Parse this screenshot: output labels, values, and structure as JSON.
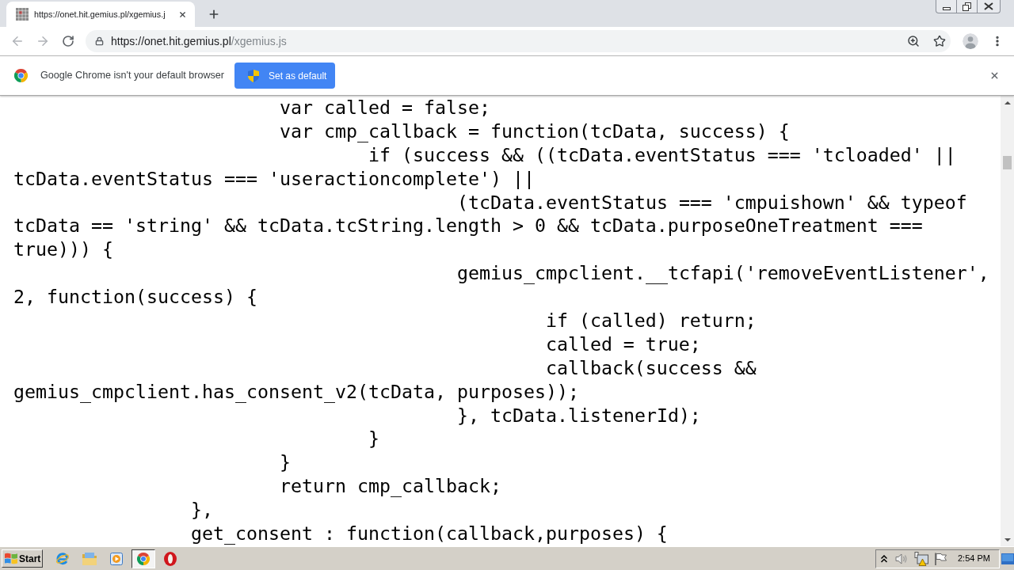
{
  "tab_strip": {
    "tabs": [
      {
        "title": "https://onet.hit.gemius.pl/xgemius.j",
        "selected": true
      }
    ]
  },
  "toolbar": {
    "url": {
      "host": "https://onet.hit.gemius.pl",
      "path": "/xgemius.js"
    }
  },
  "infobar": {
    "message": "Google Chrome isn't your default browser",
    "button": "Set as default"
  },
  "code_lines": [
    "                        var called = false;",
    "                        var cmp_callback = function(tcData, success) {",
    "                                if (success && ((tcData.eventStatus === 'tcloaded' ||",
    "tcData.eventStatus === 'useractioncomplete') ||",
    "                                        (tcData.eventStatus === 'cmpuishown' && typeof",
    "tcData == 'string' && tcData.tcString.length > 0 && tcData.purposeOneTreatment ===",
    "true))) {",
    "                                        gemius_cmpclient.__tcfapi('removeEventListener',",
    "2, function(success) {",
    "                                                if (called) return;",
    "                                                called = true;",
    "                                                callback(success &&",
    "gemius_cmpclient.has_consent_v2(tcData, purposes));",
    "                                        }, tcData.listenerId);",
    "                                }",
    "                        }",
    "                        return cmp_callback;",
    "                },",
    "                get_consent : function(callback,purposes) {"
  ],
  "taskbar": {
    "start": "Start",
    "apps": [
      {
        "kind": "ie",
        "selected": false
      },
      {
        "kind": "folder",
        "selected": false
      },
      {
        "kind": "media",
        "selected": false
      },
      {
        "kind": "chrome",
        "selected": true
      },
      {
        "kind": "opera",
        "selected": false
      }
    ],
    "clock": "2:54 PM"
  }
}
